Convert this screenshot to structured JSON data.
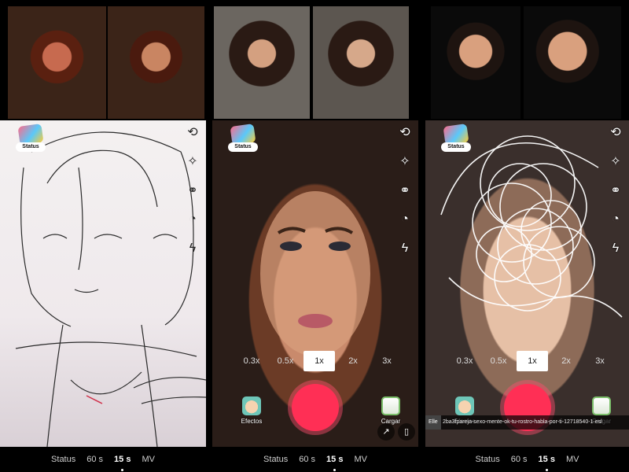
{
  "status_label": "Status",
  "zoom_levels": [
    "0.3x",
    "0.5x",
    "1x",
    "2x",
    "3x"
  ],
  "zoom_active_index": 2,
  "effects_label": "Efectos",
  "upload_label": "Cargar",
  "nav": [
    "Status",
    "60 s",
    "15 s",
    "MV"
  ],
  "nav_active_index": 2,
  "panel3": {
    "caption_prefix": "Elle",
    "caption": "2ba3fpareja-sexo-mente-ok-tu-rostro-habla-por-ti-12718540-1-esl"
  },
  "icons": {
    "flip": "flip-camera-icon",
    "magic": "magic-wand-off-icon",
    "filters": "filters-icon",
    "timer": "timer-3-icon",
    "flash": "flash-off-icon",
    "bookmark": "bookmark-icon",
    "share": "share-icon"
  },
  "colors": {
    "record": "#ff2f55",
    "background": "#000000"
  }
}
